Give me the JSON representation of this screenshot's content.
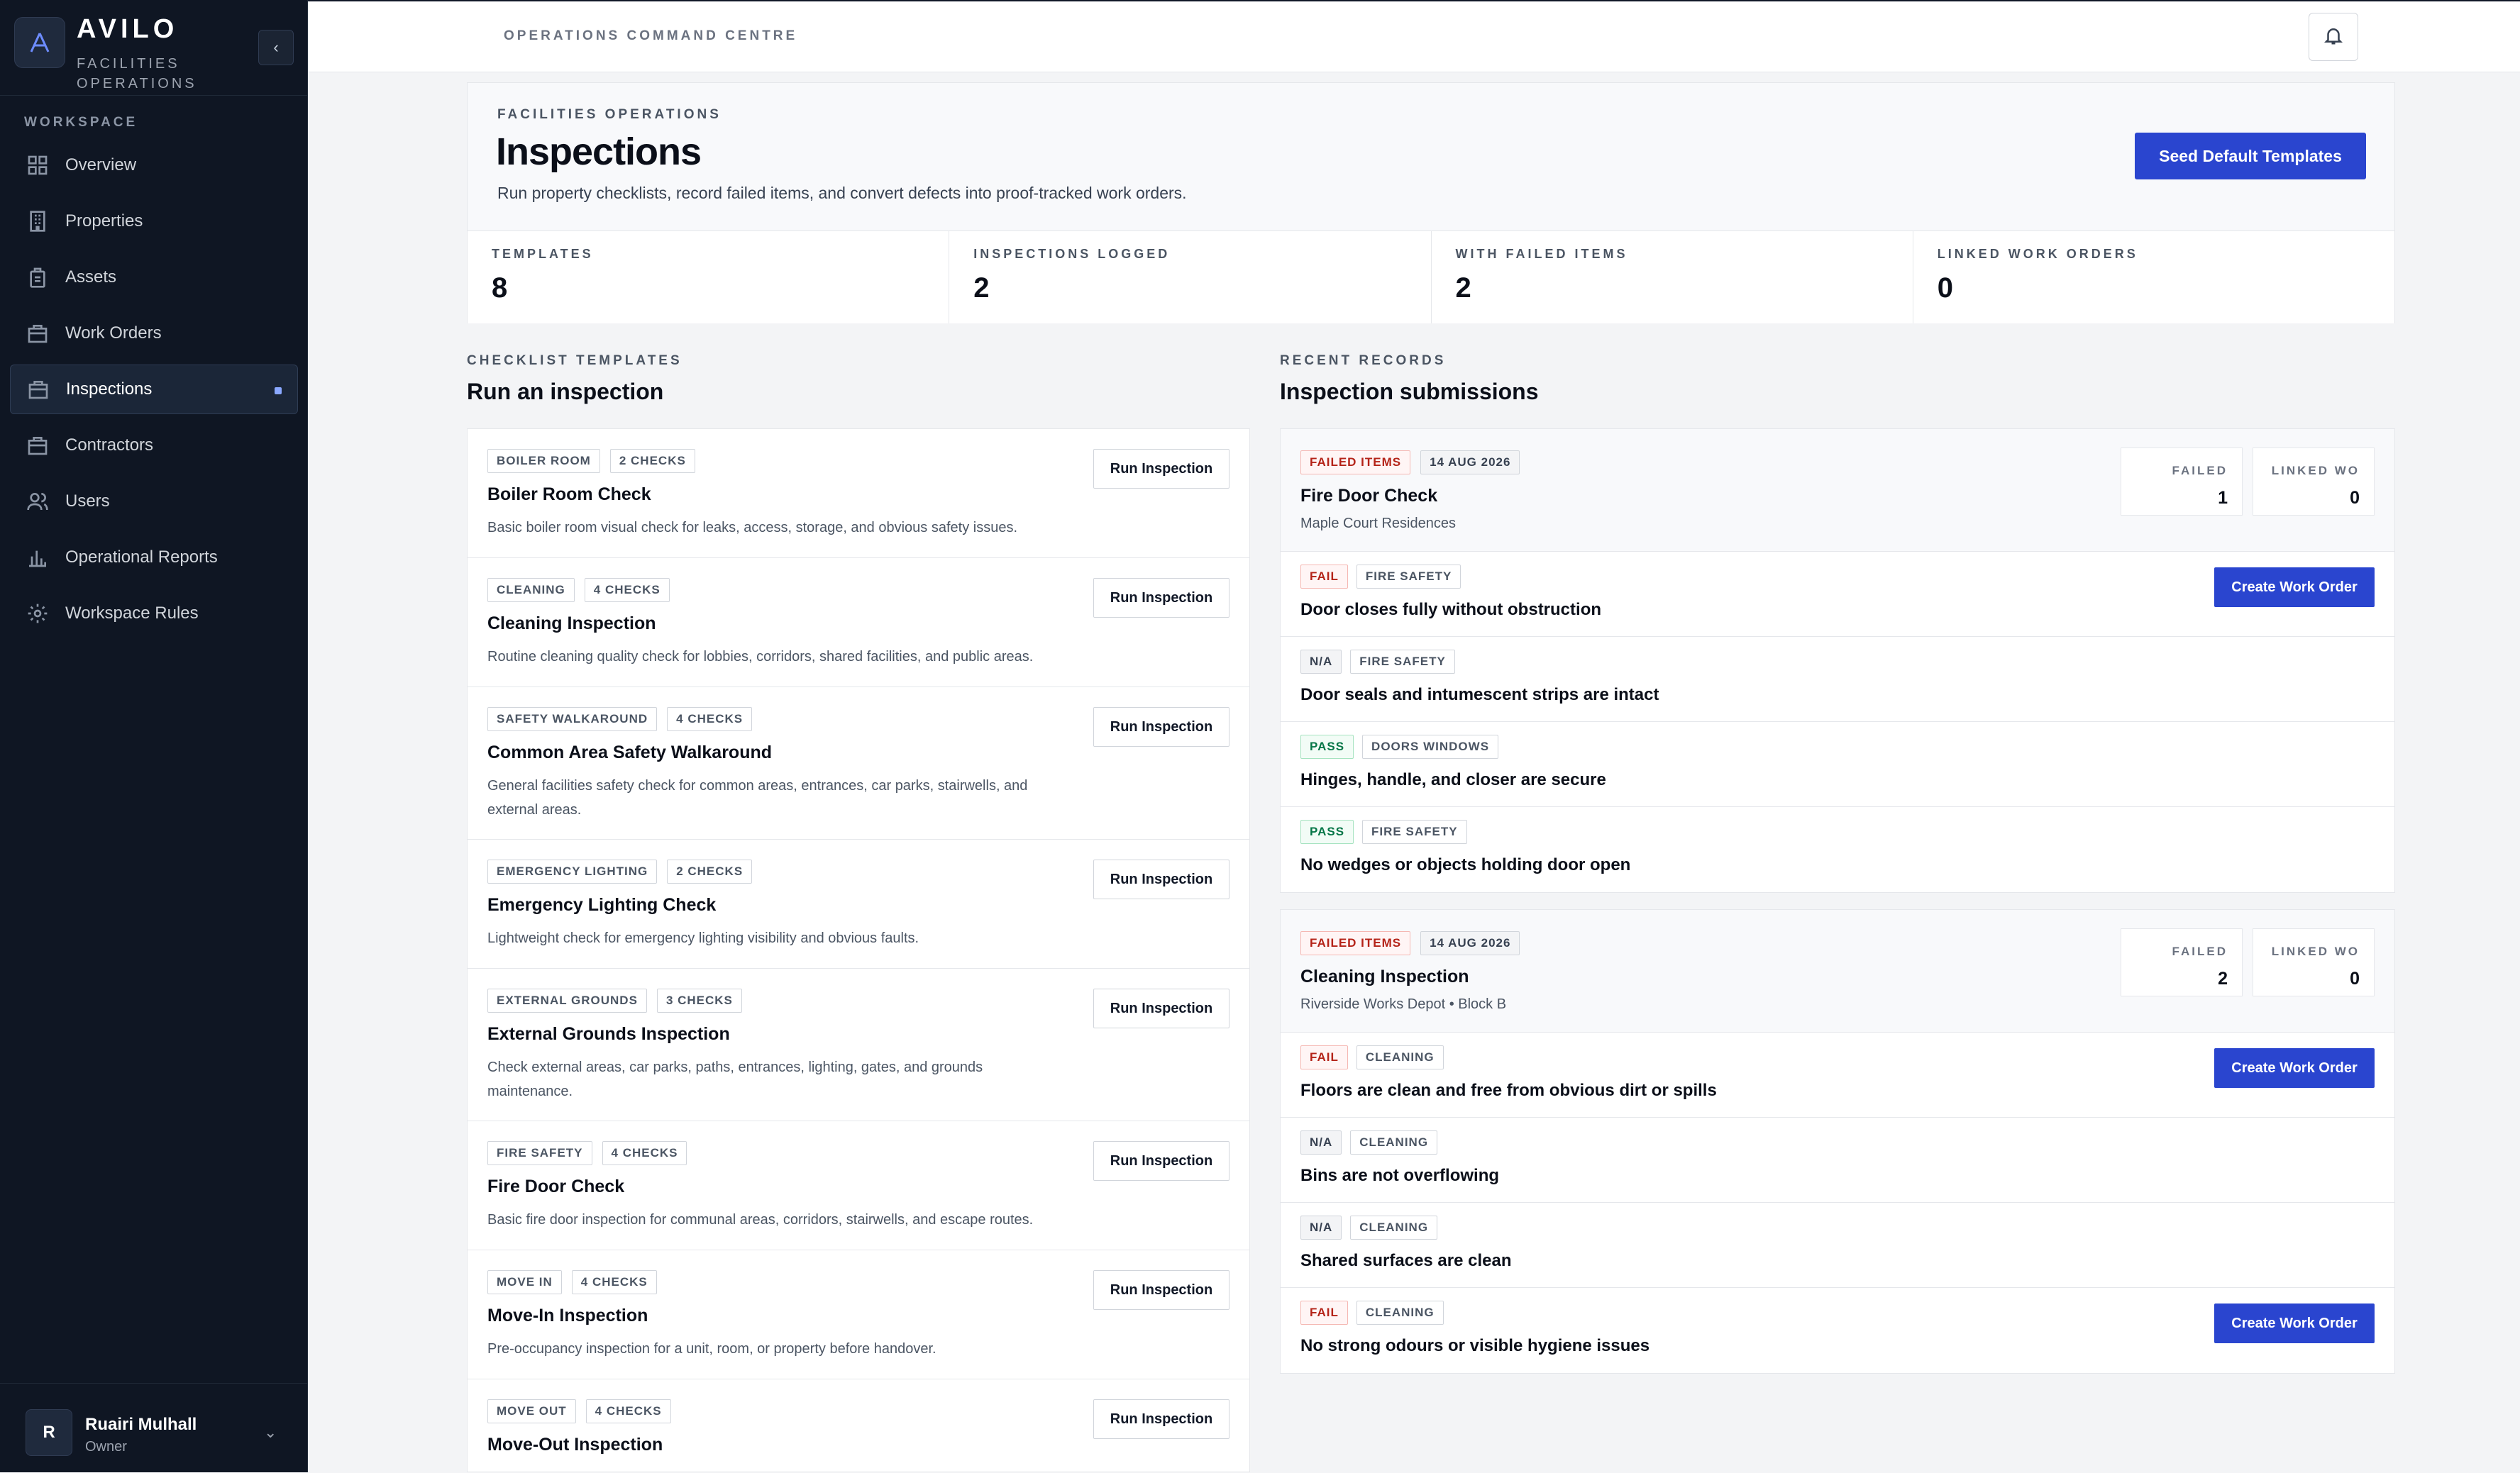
{
  "brand": {
    "name": "AVILO",
    "sub": "FACILITIES OPERATIONS",
    "collapse_icon": "‹"
  },
  "sidebar": {
    "section": "WORKSPACE",
    "items": [
      {
        "label": "Overview",
        "icon": "grid-icon"
      },
      {
        "label": "Properties",
        "icon": "building-icon"
      },
      {
        "label": "Assets",
        "icon": "asset-icon"
      },
      {
        "label": "Work Orders",
        "icon": "briefcase-icon"
      },
      {
        "label": "Inspections",
        "icon": "clipboard-icon",
        "active": true
      },
      {
        "label": "Contractors",
        "icon": "briefcase-icon"
      },
      {
        "label": "Users",
        "icon": "users-icon"
      },
      {
        "label": "Operational Reports",
        "icon": "bar-chart-icon"
      },
      {
        "label": "Workspace Rules",
        "icon": "gear-icon"
      }
    ],
    "user": {
      "initial": "R",
      "name": "Ruairi Mulhall",
      "role": "Owner",
      "chevron": "⌄"
    }
  },
  "topbar": {
    "title": "OPERATIONS COMMAND CENTRE"
  },
  "header": {
    "eyebrow": "FACILITIES OPERATIONS",
    "title": "Inspections",
    "description": "Run property checklists, record failed items, and convert defects into proof-tracked work orders.",
    "seed_button": "Seed Default Templates",
    "stats": [
      {
        "label": "TEMPLATES",
        "value": "8"
      },
      {
        "label": "INSPECTIONS LOGGED",
        "value": "2"
      },
      {
        "label": "WITH FAILED ITEMS",
        "value": "2"
      },
      {
        "label": "LINKED WORK ORDERS",
        "value": "0"
      }
    ]
  },
  "templates": {
    "eyebrow": "CHECKLIST TEMPLATES",
    "title": "Run an inspection",
    "run_label": "Run Inspection",
    "items": [
      {
        "category": "BOILER ROOM",
        "checks": "2 CHECKS",
        "name": "Boiler Room Check",
        "desc": "Basic boiler room visual check for leaks, access, storage, and obvious safety issues."
      },
      {
        "category": "CLEANING",
        "checks": "4 CHECKS",
        "name": "Cleaning Inspection",
        "desc": "Routine cleaning quality check for lobbies, corridors, shared facilities, and public areas."
      },
      {
        "category": "SAFETY WALKAROUND",
        "checks": "4 CHECKS",
        "name": "Common Area Safety Walkaround",
        "desc": "General facilities safety check for common areas, entrances, car parks, stairwells, and external areas."
      },
      {
        "category": "EMERGENCY LIGHTING",
        "checks": "2 CHECKS",
        "name": "Emergency Lighting Check",
        "desc": "Lightweight check for emergency lighting visibility and obvious faults."
      },
      {
        "category": "EXTERNAL GROUNDS",
        "checks": "3 CHECKS",
        "name": "External Grounds Inspection",
        "desc": "Check external areas, car parks, paths, entrances, lighting, gates, and grounds maintenance."
      },
      {
        "category": "FIRE SAFETY",
        "checks": "4 CHECKS",
        "name": "Fire Door Check",
        "desc": "Basic fire door inspection for communal areas, corridors, stairwells, and escape routes."
      },
      {
        "category": "MOVE IN",
        "checks": "4 CHECKS",
        "name": "Move-In Inspection",
        "desc": "Pre-occupancy inspection for a unit, room, or property before handover."
      },
      {
        "category": "MOVE OUT",
        "checks": "4 CHECKS",
        "name": "Move-Out Inspection",
        "desc": ""
      }
    ]
  },
  "records": {
    "eyebrow": "RECENT RECORDS",
    "title": "Inspection submissions",
    "failed_label": "FAILED",
    "linked_label": "LINKED WO",
    "wo_label": "Create Work Order",
    "submissions": [
      {
        "status": "FAILED ITEMS",
        "date": "14 AUG 2026",
        "name": "Fire Door Check",
        "location": "Maple Court Residences",
        "failed": "1",
        "linked": "0",
        "checks": [
          {
            "result": "FAIL",
            "category": "FIRE SAFETY",
            "label": "Door closes fully without obstruction",
            "action": true
          },
          {
            "result": "N/A",
            "category": "FIRE SAFETY",
            "label": "Door seals and intumescent strips are intact",
            "action": false
          },
          {
            "result": "PASS",
            "category": "DOORS WINDOWS",
            "label": "Hinges, handle, and closer are secure",
            "action": false
          },
          {
            "result": "PASS",
            "category": "FIRE SAFETY",
            "label": "No wedges or objects holding door open",
            "action": false
          }
        ]
      },
      {
        "status": "FAILED ITEMS",
        "date": "14 AUG 2026",
        "name": "Cleaning Inspection",
        "location": "Riverside Works Depot • Block B",
        "failed": "2",
        "linked": "0",
        "checks": [
          {
            "result": "FAIL",
            "category": "CLEANING",
            "label": "Floors are clean and free from obvious dirt or spills",
            "action": true
          },
          {
            "result": "N/A",
            "category": "CLEANING",
            "label": "Bins are not overflowing",
            "action": false
          },
          {
            "result": "N/A",
            "category": "CLEANING",
            "label": "Shared surfaces are clean",
            "action": false
          },
          {
            "result": "FAIL",
            "category": "CLEANING",
            "label": "No strong odours or visible hygiene issues",
            "action": true
          }
        ]
      }
    ]
  }
}
